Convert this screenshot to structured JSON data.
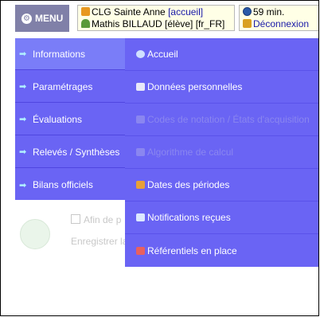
{
  "topbar": {
    "menu_label": "MENU",
    "establishment": "CLG Sainte Anne",
    "home_link": "[accueil]",
    "user": "Mathis BILLAUD [élève] [fr_FR]",
    "session_time": "59 min.",
    "logout": "Déconnexion"
  },
  "left_menu": {
    "items": [
      {
        "label": "Informations"
      },
      {
        "label": "Paramétrages"
      },
      {
        "label": "Évaluations"
      },
      {
        "label": "Relevés / Synthèses"
      },
      {
        "label": "Bilans officiels"
      }
    ]
  },
  "sub_menu": {
    "items": [
      {
        "label": "Accueil"
      },
      {
        "label": "Données personnelles"
      },
      {
        "label": "Codes de notation / États d'acquisition"
      },
      {
        "label": "Algorithme de calcul"
      },
      {
        "label": "Dates des périodes"
      },
      {
        "label": "Notifications reçues"
      },
      {
        "label": "Référentiels en place"
      }
    ]
  },
  "background": {
    "fragment1": "Afin de p",
    "fragment2": "Enregistrer la"
  }
}
